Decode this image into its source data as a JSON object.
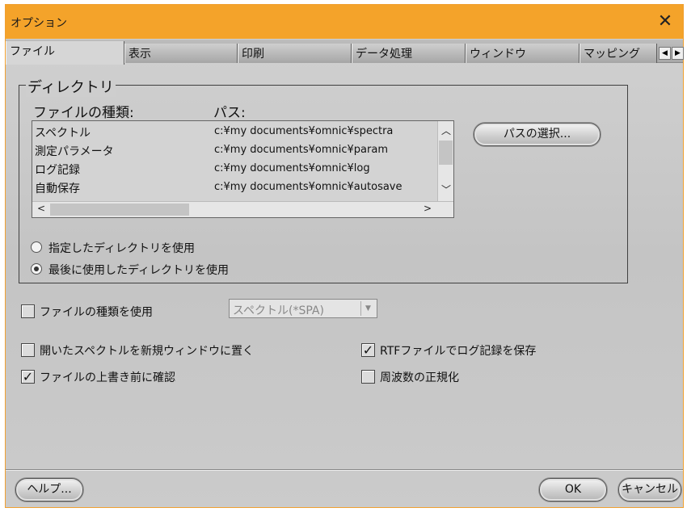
{
  "window": {
    "title": "オプション",
    "close_icon": "close-icon",
    "border_color": "#f0a030",
    "title_color": "#f4a32a"
  },
  "tabs": [
    {
      "label": "ファイル",
      "active": true
    },
    {
      "label": "表示"
    },
    {
      "label": "印刷"
    },
    {
      "label": "データ処理"
    },
    {
      "label": "ウィンドウ"
    },
    {
      "label": "マッピング"
    }
  ],
  "directory": {
    "legend": "ディレクトリ",
    "col_type": "ファイルの種類:",
    "col_path": "パス:",
    "rows": [
      {
        "type": "スペクトル",
        "path": "c:¥my documents¥omnic¥spectra"
      },
      {
        "type": "測定パラメータ",
        "path": "c:¥my documents¥omnic¥param"
      },
      {
        "type": "ログ記録",
        "path": "c:¥my documents¥omnic¥log"
      },
      {
        "type": "自動保存",
        "path": "c:¥my documents¥omnic¥autosave"
      }
    ],
    "choose_path_label": "パスの選択...",
    "radio_specified": "指定したディレクトリを使用",
    "radio_last_used": "最後に使用したディレクトリを使用",
    "selected_radio": "last_used"
  },
  "options": {
    "use_file_type": {
      "label": "ファイルの種類を使用",
      "checked": false
    },
    "file_type_select": "スペクトル(*SPA)",
    "open_in_new_window": {
      "label": "開いたスペクトルを新規ウィンドウに置く",
      "checked": false
    },
    "confirm_overwrite": {
      "label": "ファイルの上書き前に確認",
      "checked": true
    },
    "save_log_rtf": {
      "label": "RTFファイルでログ記録を保存",
      "checked": true
    },
    "normalize_frequency": {
      "label": "周波数の正規化",
      "checked": false
    }
  },
  "footer": {
    "help_label": "ヘルプ...",
    "ok_label": "OK",
    "cancel_label": "キャンセル"
  }
}
